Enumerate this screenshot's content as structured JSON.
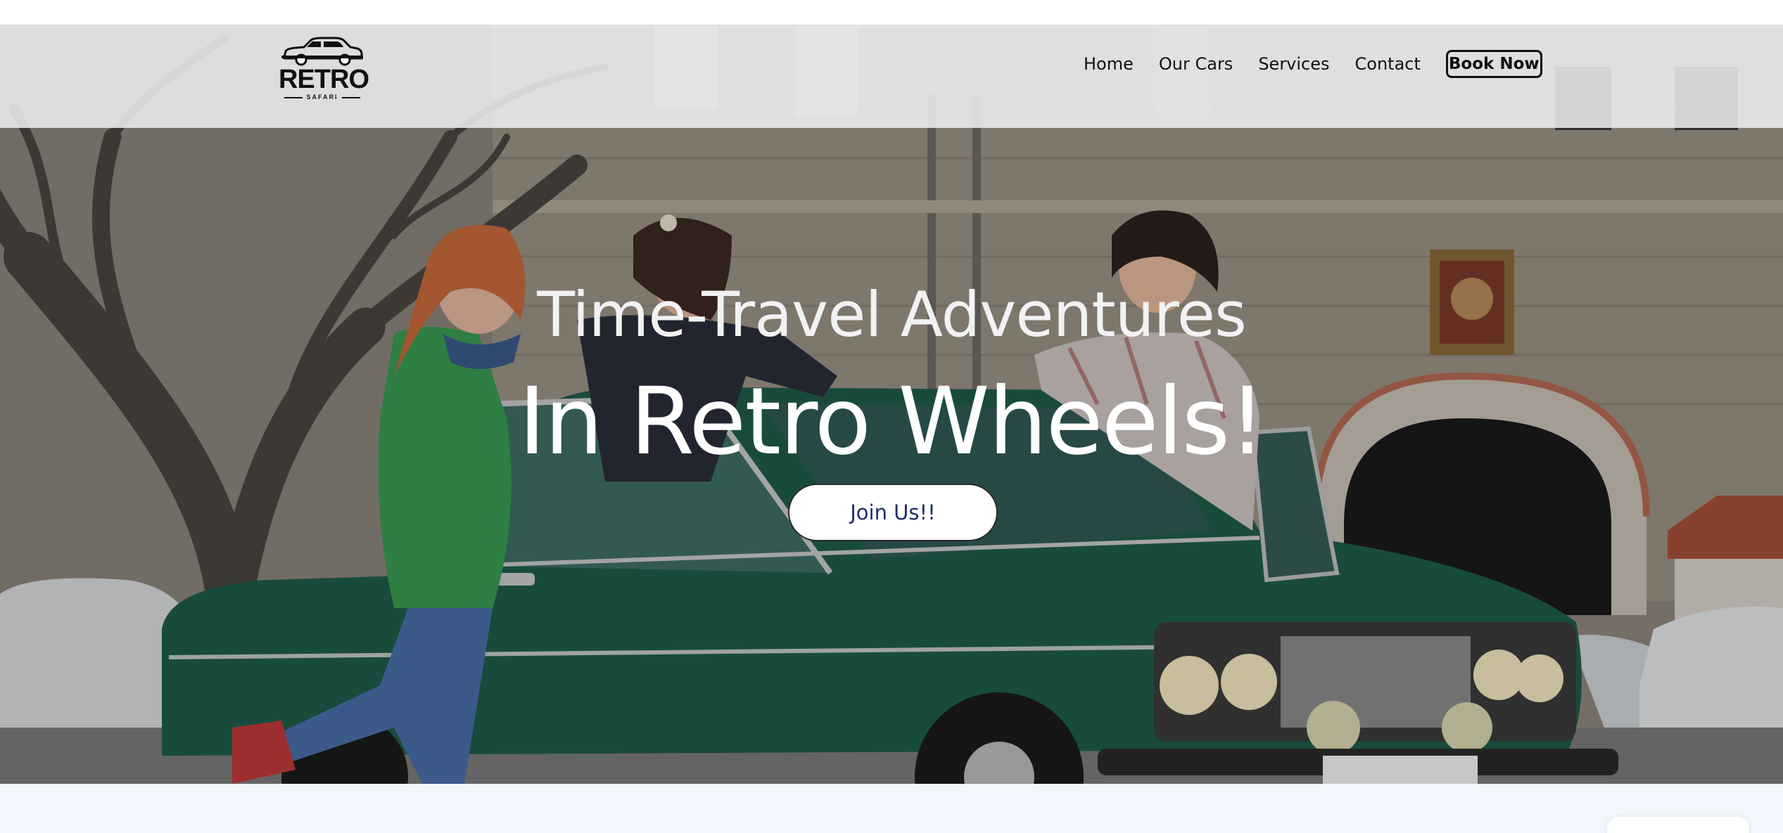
{
  "brand": {
    "logo_word": "RETRO",
    "logo_sub": "SAFARI"
  },
  "nav": {
    "items": [
      "Home",
      "Our Cars",
      "Services",
      "Contact"
    ],
    "book_label": "Book Now"
  },
  "hero": {
    "subtitle": "Time-Travel Adventures",
    "title": "In Retro Wheels!",
    "cta_label": "Join Us!!",
    "cta_text_color": "#1d2e6b"
  },
  "colors": {
    "section_background": "#f1f7fc",
    "car_green": "#1f5c4a"
  }
}
